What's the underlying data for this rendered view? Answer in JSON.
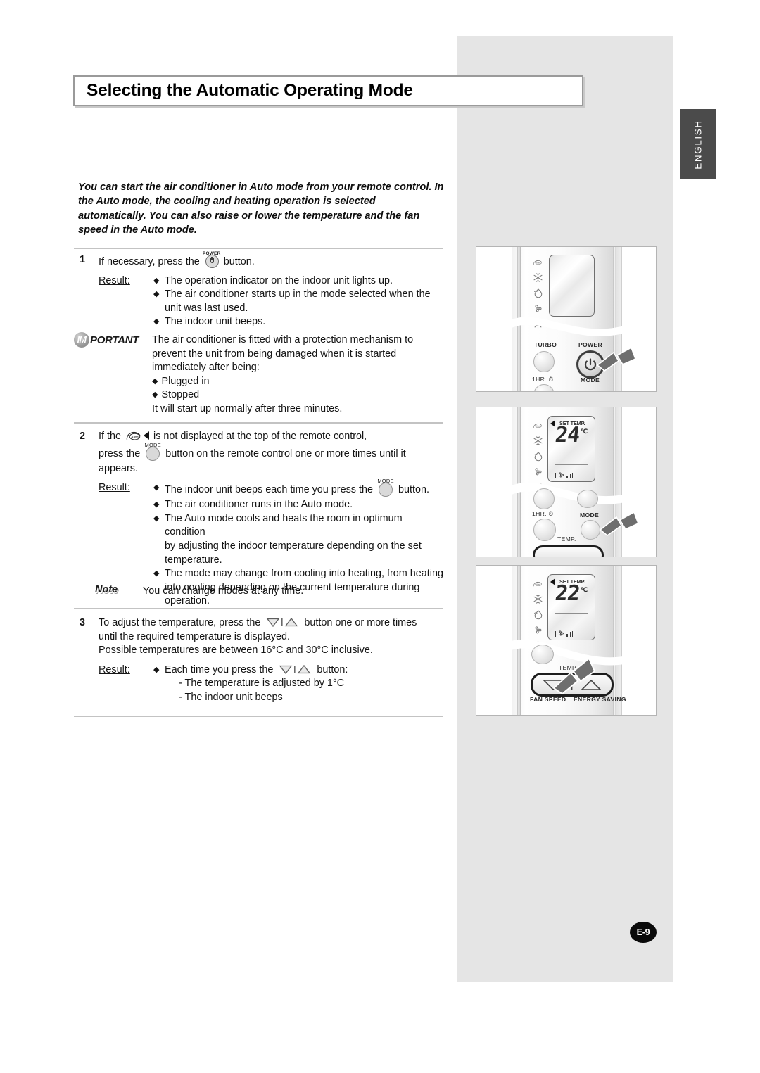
{
  "page": {
    "title": "Selecting the Automatic Operating Mode",
    "language_tab": "ENGLISH",
    "page_number": "E-9"
  },
  "intro": "You can start the air conditioner in Auto mode from your remote control. In the Auto mode, the cooling and heating operation is selected automatically. You can also raise or lower the temperature and the fan speed in the Auto mode.",
  "steps": {
    "step1": {
      "number": "1",
      "text_before_icon": "If necessary, press the",
      "icon_caption": "POWER",
      "text_after_icon": "button.",
      "result_label": "Result:",
      "results": [
        "The operation indicator on the indoor unit lights up.",
        "The air conditioner starts up in the mode selected when the unit was last used.",
        "The indoor unit beeps."
      ]
    },
    "important": {
      "badge_prefix": "IM",
      "badge_suffix": "PORTANT",
      "line1": "The air conditioner is fitted with a protection mechanism to",
      "line2": "prevent the unit from being damaged when it is started",
      "line3": "immediately after being:",
      "bullets": [
        "Plugged in",
        "Stopped"
      ],
      "closing": "It will start up normally after three minutes."
    },
    "step2": {
      "number": "2",
      "text_a": "If the",
      "text_b": "is not displayed at the top of the remote control,",
      "text_c": "press the",
      "mode_caption": "MODE",
      "text_d": "button on the remote control one or more times until it",
      "text_e": "appears.",
      "result_label": "Result:",
      "result1_a": "The indoor unit beeps each time you press the",
      "result1_b": "button.",
      "result2": "The air conditioner runs in the Auto mode.",
      "result3_line1": "The Auto mode cools and heats the room in optimum condition",
      "result3_line2": "by adjusting the indoor temperature depending on the set",
      "result3_line3": "temperature.",
      "result4_line1": "The mode may change from cooling into heating, from heating",
      "result4_line2": "into cooling depending on the current temperature during",
      "result4_line3": "operation."
    },
    "note": {
      "label": "Note",
      "text": "You can change modes at any time."
    },
    "step3": {
      "number": "3",
      "text_a": "To adjust the temperature, press the",
      "text_b": "button one or more times",
      "text_c": "until the required temperature is displayed.",
      "text_d": "Possible temperatures are between 16°C and 30°C inclusive.",
      "result_label": "Result:",
      "result1_a": "Each time you press the",
      "result1_b": "button:",
      "sub1": "- The temperature is adjusted by 1°C",
      "sub2": "- The indoor unit beeps"
    }
  },
  "illustrations": [
    {
      "id": "remote-power",
      "lcd_text": "",
      "lcd_unit": "",
      "set_temp_label": "",
      "buttons": [
        "TURBO",
        "POWER",
        "1HR.",
        "MODE"
      ],
      "mode_icons": [
        "auto-icon",
        "snowflake-icon",
        "droplet-icon",
        "fan-icon",
        "sun-icon"
      ],
      "cursor": "hand-pointer-at-power"
    },
    {
      "id": "remote-mode-24",
      "lcd_text": "24",
      "lcd_unit": "℃",
      "set_temp_label": "SET TEMP.",
      "buttons": [
        "1HR.",
        "MODE",
        "TEMP."
      ],
      "mode_icons": [
        "auto-icon",
        "snowflake-icon",
        "droplet-icon",
        "fan-icon",
        "sun-icon"
      ],
      "cursor": "hand-pointer-at-mode"
    },
    {
      "id": "remote-temp-22",
      "lcd_text": "22",
      "lcd_unit": "℃",
      "set_temp_label": "SET TEMP.",
      "buttons": [
        "TEMP.",
        "FAN SPEED",
        "ENERGY SAVING"
      ],
      "mode_icons": [
        "auto-icon",
        "snowflake-icon",
        "droplet-icon",
        "fan-icon",
        "sun-icon"
      ],
      "cursor": "hand-pointer-at-temp-down"
    }
  ],
  "colors": {
    "panel_gray": "#e5e5e5",
    "tab_dark": "#4b4b4b",
    "rule_gray": "#c3c3c3",
    "page_badge": "#0a0a0a"
  }
}
